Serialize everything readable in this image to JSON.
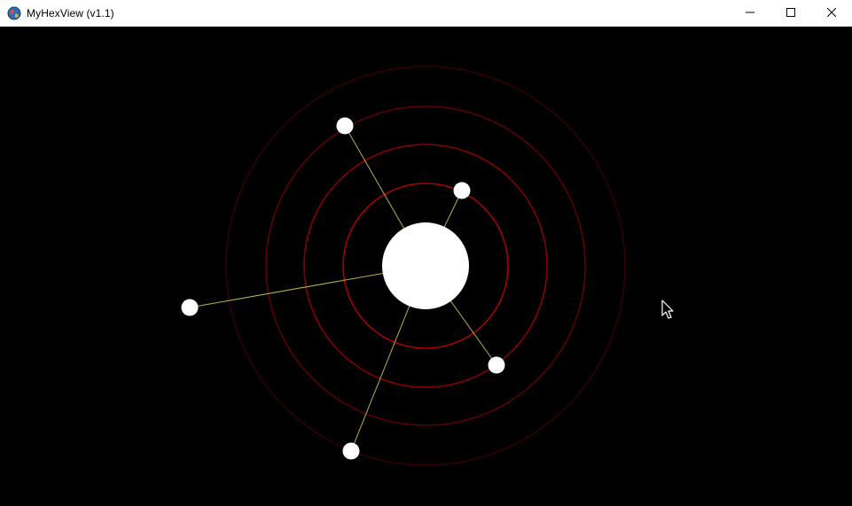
{
  "window": {
    "title": "MyHexView (v1.1)",
    "icon": "app-globe-icon",
    "controls": {
      "minimize": "minimize-icon",
      "maximize": "maximize-icon",
      "close": "close-icon"
    }
  },
  "colors": {
    "background": "#000000",
    "titlebar": "#ffffff",
    "center_node": "#ffffff",
    "satellite_node": "#ffffff",
    "link_line": "#b8b04a",
    "ring_colors": [
      "#b00000",
      "#8a0000",
      "#600000",
      "#350000"
    ]
  },
  "viz": {
    "rings": 4,
    "satellites": 5
  }
}
